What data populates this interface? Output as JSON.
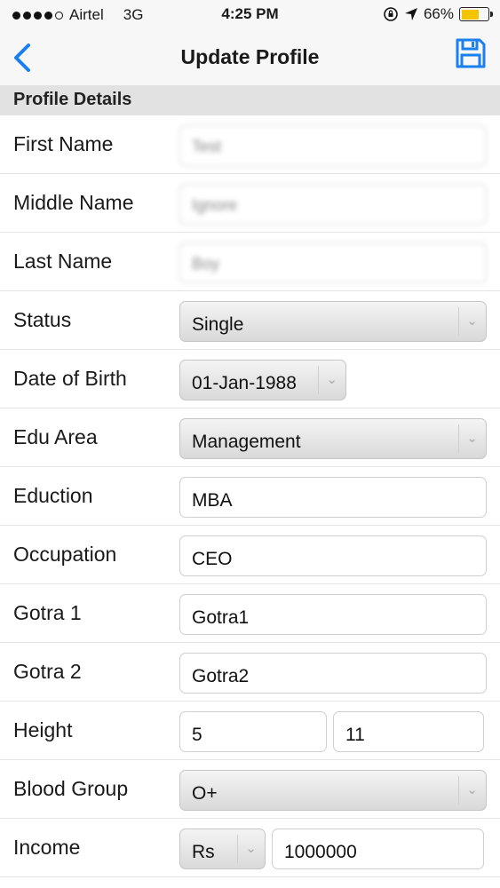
{
  "status_bar": {
    "carrier": "Airtel",
    "network": "3G",
    "time": "4:25 PM",
    "battery": "66%",
    "battery_level": 0.66
  },
  "nav": {
    "title": "Update Profile",
    "back_icon": "chevron-left-icon",
    "save_icon": "floppy-disk-icon",
    "accent_color": "#1a7ff0"
  },
  "section": {
    "title": "Profile Details"
  },
  "fields": {
    "first_name": {
      "label": "First Name",
      "value": "Test"
    },
    "middle_name": {
      "label": "Middle Name",
      "value": "Ignore"
    },
    "last_name": {
      "label": "Last Name",
      "value": "Boy"
    },
    "status": {
      "label": "Status",
      "value": "Single"
    },
    "dob": {
      "label": "Date of Birth",
      "value": "01-Jan-1988"
    },
    "edu_area": {
      "label": "Edu Area",
      "value": "Management"
    },
    "education": {
      "label": "Eduction",
      "value": "MBA"
    },
    "occupation": {
      "label": "Occupation",
      "value": "CEO"
    },
    "gotra1": {
      "label": "Gotra 1",
      "value": "Gotra1"
    },
    "gotra2": {
      "label": "Gotra 2",
      "value": "Gotra2"
    },
    "height": {
      "label": "Height",
      "feet": "5",
      "inches": "11"
    },
    "blood_group": {
      "label": "Blood Group",
      "value": "O+"
    },
    "income": {
      "label": "Income",
      "currency": "Rs",
      "value": "1000000"
    }
  }
}
